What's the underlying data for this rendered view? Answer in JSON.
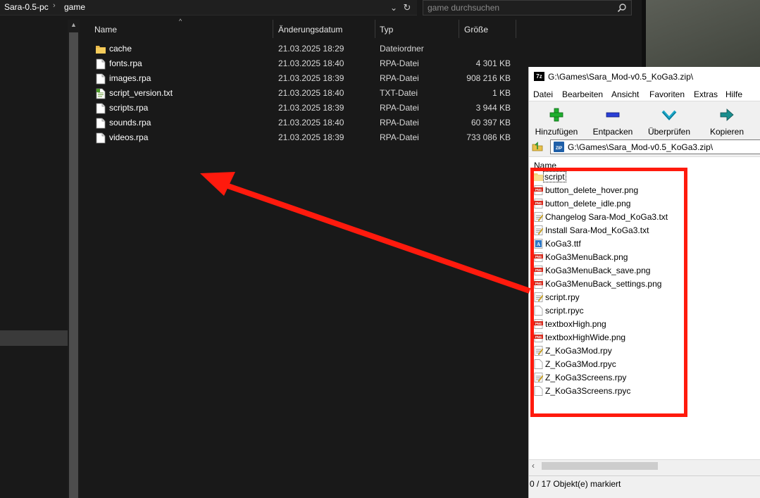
{
  "explorer": {
    "breadcrumb": [
      "Sara-0.5-pc",
      "game"
    ],
    "search_placeholder": "game durchsuchen",
    "columns": {
      "name": "Name",
      "date": "Änderungsdatum",
      "type": "Typ",
      "size": "Größe"
    },
    "files": [
      {
        "name": "cache",
        "date": "21.03.2025 18:29",
        "type": "Dateiordner",
        "size": "",
        "icon": "folder-icon"
      },
      {
        "name": "fonts.rpa",
        "date": "21.03.2025 18:40",
        "type": "RPA-Datei",
        "size": "4 301 KB",
        "icon": "file-icon"
      },
      {
        "name": "images.rpa",
        "date": "21.03.2025 18:39",
        "type": "RPA-Datei",
        "size": "908 216 KB",
        "icon": "file-icon"
      },
      {
        "name": "script_version.txt",
        "date": "21.03.2025 18:40",
        "type": "TXT-Datei",
        "size": "1 KB",
        "icon": "text-file-icon"
      },
      {
        "name": "scripts.rpa",
        "date": "21.03.2025 18:39",
        "type": "RPA-Datei",
        "size": "3 944 KB",
        "icon": "file-icon"
      },
      {
        "name": "sounds.rpa",
        "date": "21.03.2025 18:40",
        "type": "RPA-Datei",
        "size": "60 397 KB",
        "icon": "file-icon"
      },
      {
        "name": "videos.rpa",
        "date": "21.03.2025 18:39",
        "type": "RPA-Datei",
        "size": "733 086 KB",
        "icon": "file-icon"
      }
    ]
  },
  "zip": {
    "title": "G:\\Games\\Sara_Mod-v0.5_KoGa3.zip\\",
    "menu": [
      "Datei",
      "Bearbeiten",
      "Ansicht",
      "Favoriten",
      "Extras",
      "Hilfe"
    ],
    "toolbar": {
      "add": "Hinzufügen",
      "extract": "Entpacken",
      "test": "Überprüfen",
      "copy": "Kopieren"
    },
    "path": "G:\\Games\\Sara_Mod-v0.5_KoGa3.zip\\",
    "column_name": "Name",
    "items": [
      {
        "name": "script",
        "icon": "folder-icon"
      },
      {
        "name": "button_delete_hover.png",
        "icon": "png-icon"
      },
      {
        "name": "button_delete_idle.png",
        "icon": "png-icon"
      },
      {
        "name": "Changelog Sara-Mod_KoGa3.txt",
        "icon": "text-file-icon"
      },
      {
        "name": "Install Sara-Mod_KoGa3.txt",
        "icon": "text-file-icon"
      },
      {
        "name": "KoGa3.ttf",
        "icon": "font-file-icon"
      },
      {
        "name": "KoGa3MenuBack.png",
        "icon": "png-icon"
      },
      {
        "name": "KoGa3MenuBack_save.png",
        "icon": "png-icon"
      },
      {
        "name": "KoGa3MenuBack_settings.png",
        "icon": "png-icon"
      },
      {
        "name": "script.rpy",
        "icon": "text-file-icon"
      },
      {
        "name": "script.rpyc",
        "icon": "file-icon"
      },
      {
        "name": "textboxHigh.png",
        "icon": "png-icon"
      },
      {
        "name": "textboxHighWide.png",
        "icon": "png-icon"
      },
      {
        "name": "Z_KoGa3Mod.rpy",
        "icon": "text-file-icon"
      },
      {
        "name": "Z_KoGa3Mod.rpyc",
        "icon": "file-icon"
      },
      {
        "name": "Z_KoGa3Screens.rpy",
        "icon": "text-file-icon"
      },
      {
        "name": "Z_KoGa3Screens.rpyc",
        "icon": "file-icon"
      }
    ],
    "status": "0 / 17 Objekt(e) markiert"
  },
  "colors": {
    "annotation": "#ff1a0d",
    "explorer_bg": "#191919",
    "zip_bg": "#f0f0f0"
  }
}
